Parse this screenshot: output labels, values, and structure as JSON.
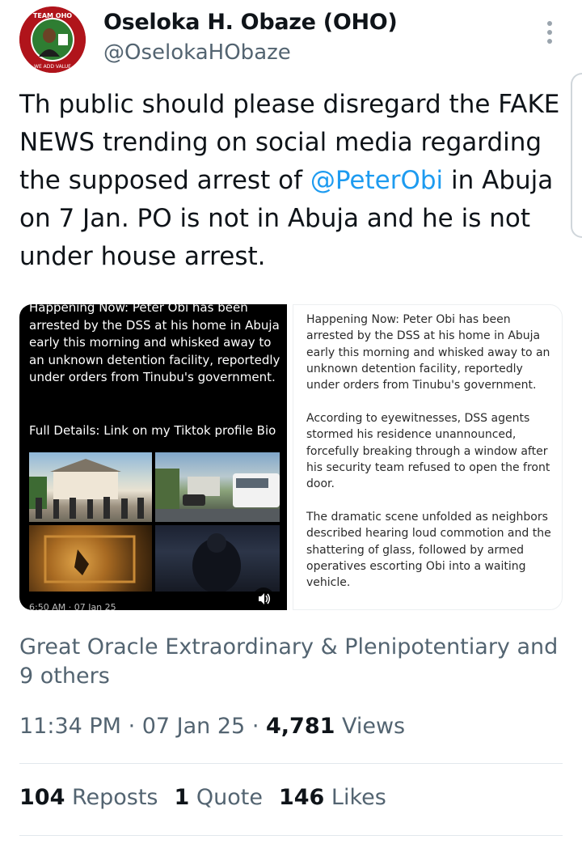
{
  "author": {
    "name": "Oseloka H. Obaze (OHO)",
    "handle": "@OselokaHObaze",
    "avatar_ring_text_top": "TEAM OHO",
    "avatar_ring_text_bottom": "WE ADD VALUE"
  },
  "tweet": {
    "text_before": "Th public should please disregard the FAKE NEWS trending on social media regarding the supposed arrest of ",
    "mention": "@PeterObi",
    "text_after": " in Abuja on 7 Jan.  PO is not in Abuja and he is not under house arrest."
  },
  "media_left": {
    "text": "Happening Now: Peter Obi has been arrested by the DSS at his home in Abuja early this morning and whisked away to an unknown detention facility, reportedly under orders from Tinubu's government.",
    "details": "Full Details: Link on my Tiktok profile Bio",
    "timestamp": "6:50 AM · 07 Jan 25"
  },
  "media_right": {
    "para1": "Happening Now: Peter Obi has been arrested by the DSS at his home in Abuja early this morning and whisked away to an unknown detention facility, reportedly under orders from Tinubu's government.",
    "para2": "According to eyewitnesses, DSS agents stormed his residence unannounced, forcefully breaking through a window after his security team refused to open the front door.",
    "para3": "The dramatic scene unfolded as neighbors described hearing loud commotion and the shattering of glass, followed by armed operatives escorting Obi into a waiting vehicle."
  },
  "liked_by": "Great Oracle Extraordinary & Plenipotentiary and 9 others",
  "meta": {
    "time": "11:34 PM",
    "sep": " · ",
    "date": "07 Jan 25",
    "views_count": "4,781",
    "views_label": " Views"
  },
  "stats": {
    "reposts_count": "104",
    "reposts_label": " Reposts",
    "quotes_count": "1",
    "quotes_label": " Quote",
    "likes_count": "146",
    "likes_label": " Likes"
  },
  "colors": {
    "text": "#0f1419",
    "secondary": "#536471",
    "link": "#1d9bf0",
    "avatar_red": "#b0141b",
    "avatar_green": "#2e7d32"
  }
}
